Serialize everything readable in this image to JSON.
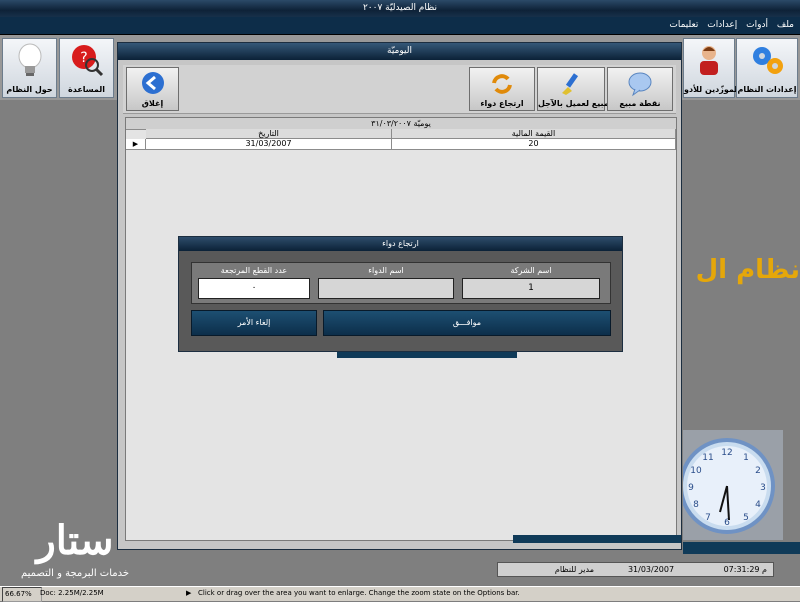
{
  "app": {
    "title": "نظام الصيدليّة ٢٠٠٧",
    "banner_text": "نظام ال"
  },
  "menu": [
    "ملف",
    "أدوات",
    "إعدادات",
    "تعليمات"
  ],
  "toolbar": {
    "left": [
      {
        "label": "حول النظام",
        "icon": "lightbulb-icon"
      },
      {
        "label": "المساعدة",
        "icon": "help-magnifier-icon"
      }
    ],
    "right": [
      {
        "label": "إعدادات النظام",
        "icon": "gears-icon"
      },
      {
        "label": "الموزّدين للأدو",
        "icon": "user-icon"
      }
    ]
  },
  "daily_window": {
    "title": "اليوميّة",
    "buttons": [
      {
        "label": "نقطة مبيع",
        "icon": "speech-bubble-icon"
      },
      {
        "label": "مبيع لعميل بالآجل",
        "icon": "paintbrush-icon"
      },
      {
        "label": "ارتجاع دواء",
        "icon": "refresh-icon"
      },
      {
        "label": "إغلاق",
        "icon": "back-arrow-icon"
      }
    ],
    "grid": {
      "caption": "يوميّة ٣١/٠٣/٢٠٠٧",
      "columns": [
        "القيمة المالية",
        "التاريخ"
      ],
      "rows": [
        [
          "20",
          "31/03/2007"
        ]
      ],
      "row_indicator": "▶"
    }
  },
  "return_dialog": {
    "title": "ارتجاع دواء",
    "fields": {
      "company_label": "اسم الشركة",
      "company_value": "1",
      "drug_label": "اسم الدواء",
      "drug_value": "",
      "qty_label": "عدد القطع المرتجعة",
      "qty_value": "٠"
    },
    "ok_label": "موافـــق",
    "cancel_label": "إلغاء الأمر"
  },
  "status": {
    "time": "07:31:29 م",
    "date": "31/03/2007",
    "user": "مدير للنظام"
  },
  "bottom": {
    "zoom": "66.67%",
    "doc": "Doc: 2.25M/2.25M",
    "hint": "Click or drag over the area you want to enlarge. Change the zoom state on the Options bar."
  },
  "logo": {
    "text": "ستار",
    "subtitle": "خدمات البرمجة و التصميم"
  },
  "colors": {
    "accent": "#0f3a58",
    "banner": "#e5a70a"
  }
}
